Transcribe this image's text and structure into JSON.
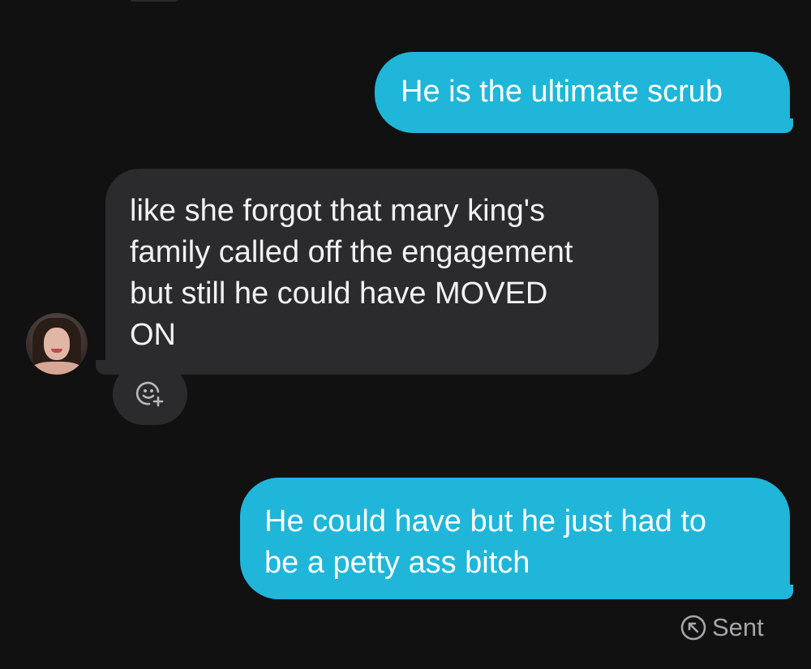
{
  "conversation": {
    "messages": [
      {
        "direction": "outgoing",
        "text": "He is the ultimate scrub"
      },
      {
        "direction": "incoming",
        "text": "like she forgot that mary king's\nfamily called off the engagement\nbut still he could have MOVED\nON"
      },
      {
        "direction": "outgoing",
        "text": "He could have but he just had to\nbe a petty ass bitch"
      }
    ],
    "status": {
      "label": "Sent",
      "icon": "sent-arrow-icon"
    }
  },
  "icons": {
    "reaction": "add-reaction-icon",
    "avatar": "contact-avatar"
  },
  "colors": {
    "background": "#111112",
    "outgoing_bubble": "#1fb6d9",
    "incoming_bubble": "#2b2b2d",
    "status_text": "#a6a6a8"
  }
}
